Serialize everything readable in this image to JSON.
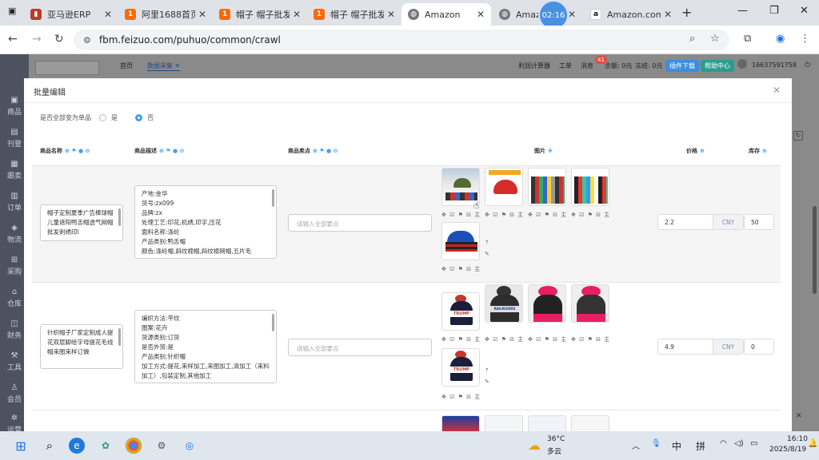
{
  "browser": {
    "tabs": [
      {
        "title": "亚马逊ERP",
        "icon": "erp-icon",
        "color": "#c0392b",
        "active": false
      },
      {
        "title": "阿里1688首页",
        "icon": "1688-icon",
        "color": "#ff6a00",
        "active": false
      },
      {
        "title": "帽子 帽子批发",
        "icon": "1688-icon",
        "color": "#ff6a00",
        "active": false
      },
      {
        "title": "帽子 帽子批发",
        "icon": "1688-icon",
        "color": "#ff6a00",
        "active": false
      },
      {
        "title": "Amazon",
        "icon": "globe-icon",
        "color": "#555",
        "active": true
      },
      {
        "title": "Amazo",
        "icon": "globe-icon",
        "color": "#555",
        "active": false
      },
      {
        "title": "Amazon.com",
        "icon": "amazon-icon",
        "color": "#222",
        "active": false
      }
    ],
    "clock_bubble": "02:16",
    "url": "fbm.feizuo.com/puhuo/common/crawl"
  },
  "app": {
    "nav_tabs": [
      "首页",
      "数据采集"
    ],
    "top_right": {
      "profit_calc": "利润计算器",
      "tools": "工单",
      "messages": "消息",
      "msg_badge": "41",
      "balance": "余额: 0元",
      "frozen": "冻结: 0元",
      "plugin_download": "插件下载",
      "help_center": "帮助中心",
      "phone": "16637591758"
    },
    "sidebar": [
      "商品",
      "刊登",
      "跟卖",
      "订单",
      "物流",
      "采购",
      "仓库",
      "财务",
      "工具",
      "会员",
      "运营"
    ]
  },
  "modal": {
    "title": "批量编辑",
    "variant_question": "是否全部变为单品",
    "option_yes": "是",
    "option_no": "否",
    "columns": {
      "name": "商品名称",
      "desc": "商品描述",
      "selling_points": "商品卖点",
      "images": "图片",
      "price": "价格",
      "stock": "库存"
    },
    "selling_placeholder": "请输入全部要点",
    "rows": [
      {
        "name": "帽子定制夏季广告棒球帽儿童遮阳鸭舌帽透气网帽批发刺绣印l",
        "desc": [
          "产地:金华",
          "货号:zx099",
          "品牌:zx",
          "处理工艺:印花,机绣,印字,压花",
          "面料名称:涤纶",
          "产品类别:鸭舌帽",
          "颜色:涤纶帽,斜纹棉帽,斜纹棉网帽,五片毛"
        ],
        "price": "2.2",
        "currency": "CNY",
        "stock": "50"
      },
      {
        "name": "针织帽子厂家定制成人提花双层脚绘字母提花毛线帽来图来样订做",
        "desc": [
          "编织方法:平纹",
          "图案:花卉",
          "货源类别:订货",
          "是否外贸:是",
          "产品类别:针织帽",
          "加工方式:提花,来样加工,来图加工,清加工（来料加工）,包装定制,其他加工"
        ],
        "price": "4.9",
        "currency": "CNY",
        "stock": "0"
      }
    ],
    "trump_text": "TRUMP",
    "railriders_text": "RAILRIDERS"
  },
  "taskbar": {
    "weather_temp": "36°C",
    "weather_desc": "多云",
    "ime1": "中",
    "ime2": "拼",
    "time": "16:10",
    "date": "2025/8/19"
  }
}
